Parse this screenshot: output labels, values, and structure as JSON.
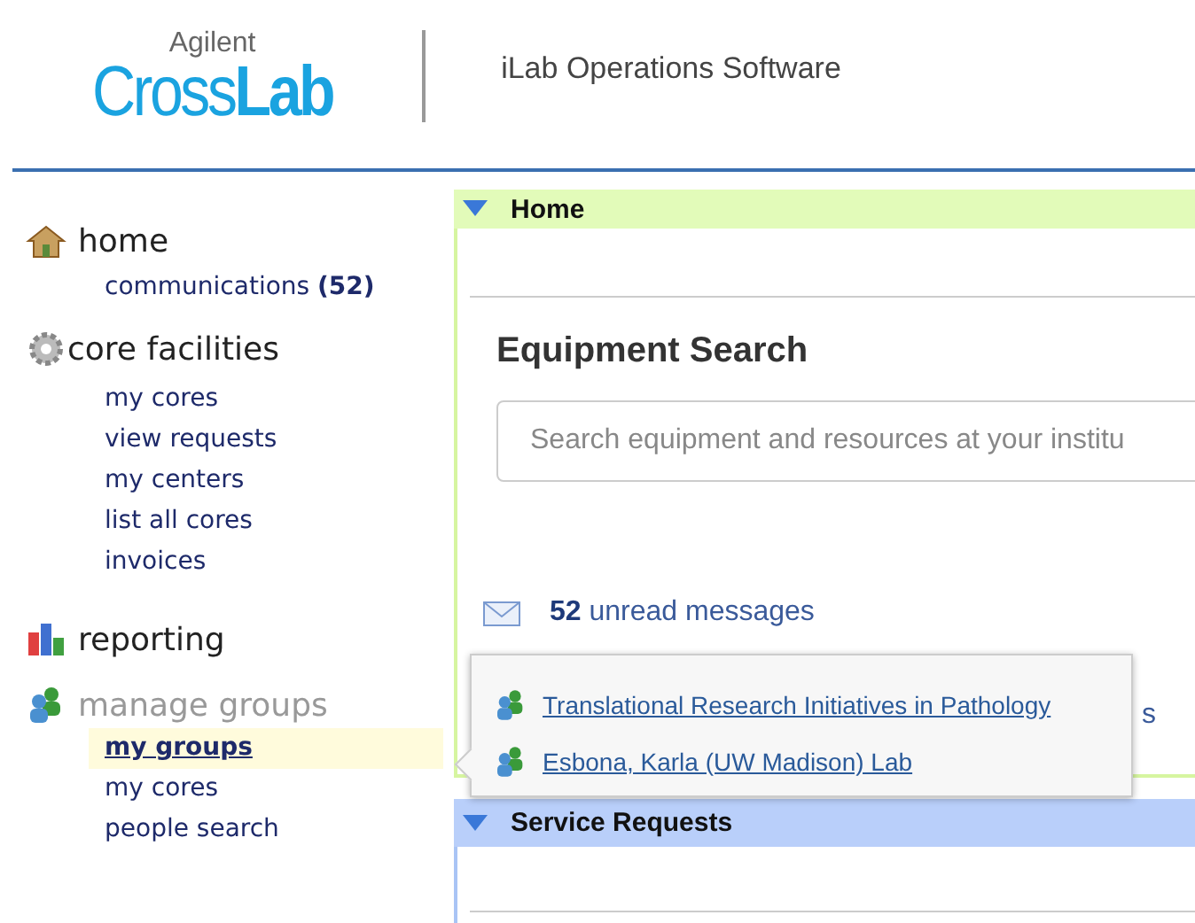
{
  "header": {
    "logo_top": "Agilent",
    "logo_light": "Cross",
    "logo_bold": "Lab",
    "product": "iLab Operations Software"
  },
  "sidebar": {
    "sections": [
      {
        "label": "home",
        "kind": "house",
        "muted": false,
        "items": [
          {
            "label": "communications **(52)**",
            "selected": false
          }
        ]
      },
      {
        "label": "core facilities",
        "kind": "gear",
        "muted": false,
        "items": [
          {
            "label": "my cores",
            "selected": false
          },
          {
            "label": "view requests",
            "selected": false
          },
          {
            "label": "my centers",
            "selected": false
          },
          {
            "label": "list all cores",
            "selected": false
          },
          {
            "label": "invoices",
            "selected": false
          }
        ]
      },
      {
        "label": "reporting",
        "kind": "chart",
        "muted": false
      },
      {
        "label": "manage groups",
        "kind": "group",
        "muted": true,
        "items": [
          {
            "label": "my groups",
            "selected": true
          },
          {
            "label": "my cores",
            "selected": false
          },
          {
            "label": "people search",
            "selected": false
          }
        ]
      }
    ]
  },
  "panels": [
    {
      "title": "Home",
      "color": "#e2fbb9",
      "expanded": true,
      "kind": "home",
      "search": {
        "heading": "Equipment Search",
        "placeholder": "Search equipment and resources at your institu"
      },
      "messages": {
        "count": "52",
        "label": "unread messages"
      },
      "covered_text": "s"
    },
    {
      "title": "Service Requests",
      "color": "#b9cffa",
      "expanded": true,
      "kind": "service"
    }
  ],
  "popup": {
    "items": [
      {
        "label": "Translational Research Initiatives in Pathology"
      },
      {
        "label": "Esbona, Karla (UW Madison) Lab"
      }
    ]
  }
}
